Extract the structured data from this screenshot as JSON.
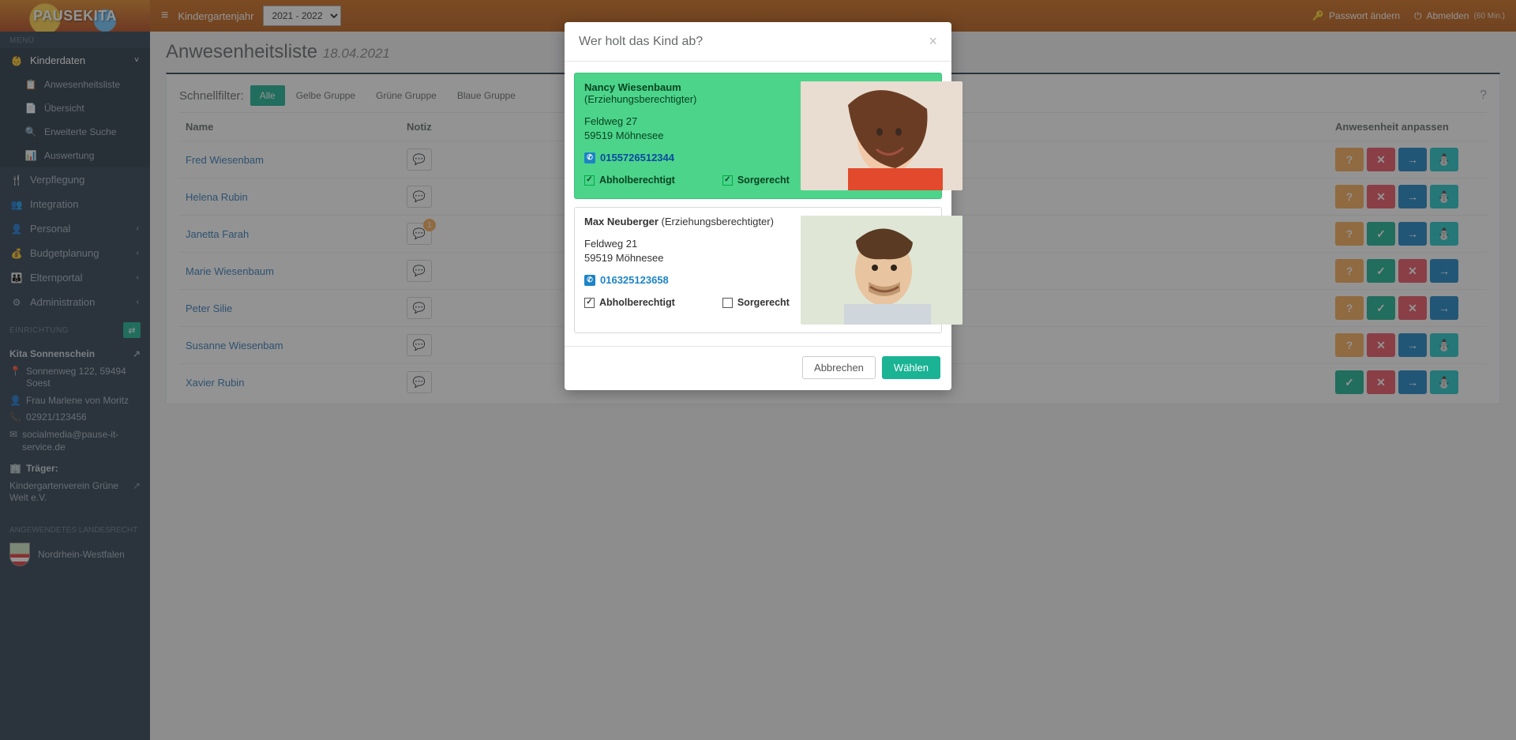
{
  "logo": "PAUSEKITA",
  "sidebar": {
    "menu_label": "MENÜ",
    "items": [
      {
        "icon": "👶",
        "label": "Kinderdaten",
        "expandable": true,
        "active": true,
        "chev": "˅"
      },
      {
        "icon": "📋",
        "label": "Anwesenheitsliste",
        "sub": true
      },
      {
        "icon": "📄",
        "label": "Übersicht",
        "sub": true
      },
      {
        "icon": "🔍",
        "label": "Erweiterte Suche",
        "sub": true
      },
      {
        "icon": "📊",
        "label": "Auswertung",
        "sub": true
      },
      {
        "icon": "🍴",
        "label": "Verpflegung"
      },
      {
        "icon": "👥",
        "label": "Integration"
      },
      {
        "icon": "👤",
        "label": "Personal",
        "chev": "‹"
      },
      {
        "icon": "💰",
        "label": "Budgetplanung",
        "chev": "‹"
      },
      {
        "icon": "👪",
        "label": "Elternportal",
        "chev": "‹"
      },
      {
        "icon": "⚙",
        "label": "Administration",
        "chev": "‹"
      }
    ],
    "einrichtung_label": "EINRICHTUNG",
    "kita_name": "Kita Sonnenschein",
    "address": "Sonnenweg 122, 59494 Soest",
    "person": "Frau Marlene von Moritz",
    "phone": "02921/123456",
    "email": "socialmedia@pause-it-service.de",
    "traeger_label": "Träger:",
    "traeger": "Kindergartenverein Grüne Welt e.V.",
    "land_label": "ANGEWENDETES LANDESRECHT",
    "land": "Nordrhein-Westfalen"
  },
  "topbar": {
    "year_label": "Kindergartenjahr",
    "year_value": "2021 - 2022",
    "pw": "Passwort ändern",
    "logout": "Abmelden",
    "logout_suffix": "(60 Min.)"
  },
  "page": {
    "title": "Anwesenheitsliste",
    "date": "18.04.2021",
    "filter_label": "Schnellfilter:",
    "filters": [
      "Alle",
      "Gelbe Gruppe",
      "Grüne Gruppe",
      "Blaue Gruppe"
    ],
    "cols": {
      "name": "Name",
      "note": "Notiz",
      "adjust": "Anwesenheit anpassen"
    },
    "rows": [
      {
        "name": "Fred Wiesenbam",
        "badge": null,
        "btns": [
          "?",
          "x",
          "→",
          "child"
        ]
      },
      {
        "name": "Helena Rubin",
        "badge": null,
        "btns": [
          "?",
          "x",
          "→",
          "child"
        ]
      },
      {
        "name": "Janetta Farah",
        "badge": "1",
        "btns": [
          "?",
          "✓g",
          "→",
          "child"
        ]
      },
      {
        "name": "Marie Wiesenbaum",
        "badge": null,
        "btns": [
          "?",
          "✓g",
          "xr",
          "→"
        ]
      },
      {
        "name": "Peter Silie",
        "badge": null,
        "btns": [
          "?",
          "✓g",
          "xr",
          "→"
        ]
      },
      {
        "name": "Susanne Wiesenbam",
        "badge": null,
        "btns": [
          "?",
          "x",
          "→",
          "child"
        ]
      },
      {
        "name": "Xavier Rubin",
        "badge": null,
        "btns": [
          "✓g",
          "xr",
          "→",
          "child"
        ]
      }
    ]
  },
  "modal": {
    "title": "Wer holt das Kind ab?",
    "cancel": "Abbrechen",
    "select": "Wählen",
    "cards": [
      {
        "selected": true,
        "name": "Nancy Wiesenbaum",
        "role": "(Erziehungsberechtigter)",
        "addr1": "Feldweg 27",
        "addr2": "59519 Möhnesee",
        "phone": "0155726512344",
        "abhol": true,
        "abhol_label": "Abholberechtigt",
        "sorge": true,
        "sorge_label": "Sorgerecht"
      },
      {
        "selected": false,
        "name": "Max Neuberger",
        "role": "(Erziehungsberechtigter)",
        "addr1": "Feldweg 21",
        "addr2": "59519 Möhnesee",
        "phone": "016325123658",
        "abhol": true,
        "abhol_label": "Abholberechtigt",
        "sorge": false,
        "sorge_label": "Sorgerecht"
      }
    ]
  }
}
